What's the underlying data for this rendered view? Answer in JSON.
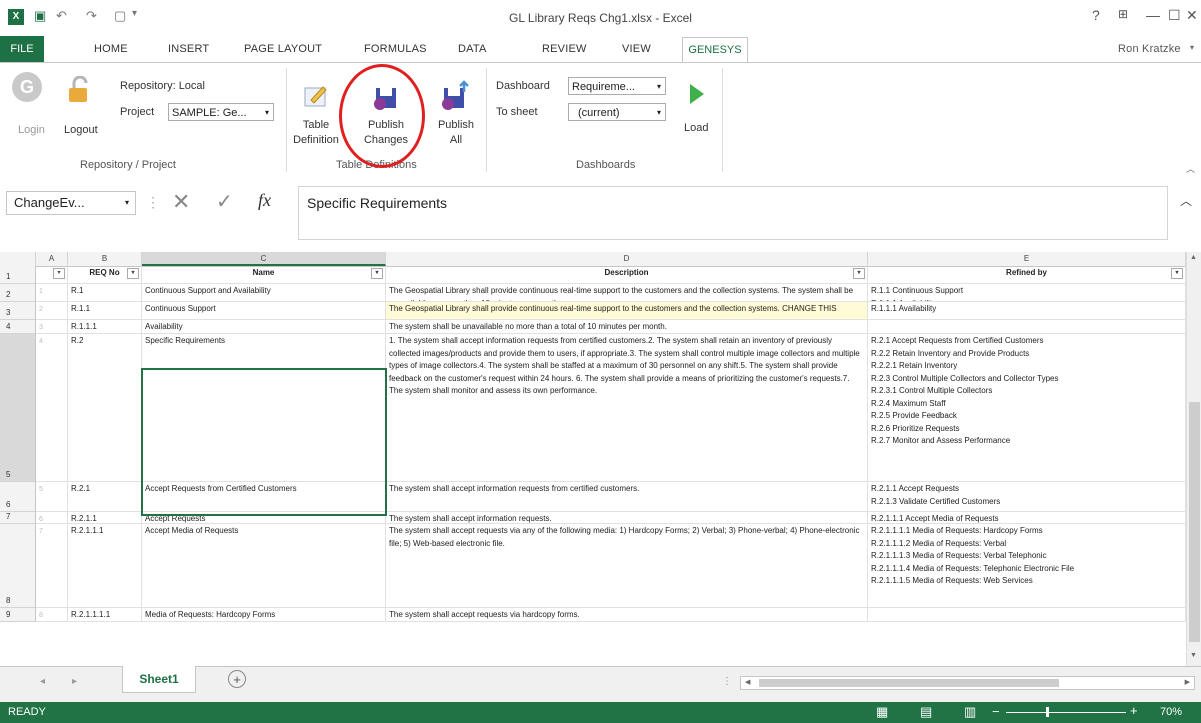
{
  "app": {
    "title": "GL Library Reqs Chg1.xlsx - Excel",
    "user": "Ron Kratzke",
    "window_controls": [
      "?",
      "□",
      "—",
      "☐",
      "✕"
    ]
  },
  "ribbon_tabs": [
    {
      "label": "FILE"
    },
    {
      "label": "HOME"
    },
    {
      "label": "INSERT"
    },
    {
      "label": "PAGE LAYOUT"
    },
    {
      "label": "FORMULAS"
    },
    {
      "label": "DATA"
    },
    {
      "label": "REVIEW"
    },
    {
      "label": "VIEW"
    },
    {
      "label": "GENESYS",
      "active": true
    }
  ],
  "ribbon": {
    "repo": {
      "login": "Login",
      "logout": "Logout",
      "repository_label": "Repository: Local",
      "project_label": "Project",
      "project_value": "SAMPLE: Ge...",
      "group_label": "Repository / Project"
    },
    "table": {
      "table_definition": [
        "Table",
        "Definition"
      ],
      "publish_changes": [
        "Publish",
        "Changes"
      ],
      "publish_all": [
        "Publish",
        "All"
      ],
      "group_label": "Table Definitions"
    },
    "dash": {
      "dashboard_label": "Dashboard",
      "dashboard_value": "Requireme...",
      "tosheet_label": "To sheet",
      "tosheet_value": "(current)",
      "load": "Load",
      "group_label": "Dashboards"
    }
  },
  "formula_bar": {
    "name_box": "ChangeEv...",
    "fx": "fx",
    "content": "Specific Requirements"
  },
  "columns": [
    "A",
    "B",
    "C",
    "D",
    "E"
  ],
  "headers": {
    "b": "REQ No",
    "c": "Name",
    "d": "Description",
    "e": "Refined by"
  },
  "rows": [
    {
      "num": "2",
      "a": "1",
      "b": "R.1",
      "c": "Continuous Support and Availability",
      "d": "The Geospatial Library shall provide continuous real-time support to the customers and the collection systems. The system shall be unavailable no more than 10 minutes per month.",
      "e": [
        "R.1.1 Continuous Support",
        "R.1.1.1 Availability"
      ]
    },
    {
      "num": "3",
      "a": "2",
      "b": "R.1.1",
      "c": "Continuous Support",
      "d": "The Geospatial Library shall provide continuous real-time support to the customers and the collection systems.  CHANGE THIS",
      "e": [
        "R.1.1.1 Availability"
      ]
    },
    {
      "num": "4",
      "a": "3",
      "b": "R.1.1.1",
      "c": "Availability",
      "d": "The system shall be unavailable no more than a total of 10 minutes per month.",
      "e": []
    },
    {
      "num": "5",
      "a": "4",
      "b": "R.2",
      "c": "Specific Requirements",
      "d": "1. The system shall accept information requests from certified customers.2. The system shall retain an inventory of previously collected images/products and provide them to users, if appropriate.3. The system shall control multiple image collectors and multiple types of image collectors.4. The system shall be staffed at a maximum of 30 personnel on any shift.5. The system shall provide feedback on the customer's request within 24 hours. 6. The system shall provide a means of prioritizing the customer's requests.7. The system shall monitor and assess its own performance.",
      "e": [
        "R.2.1 Accept Requests from Certified Customers",
        "R.2.2 Retain Inventory and Provide Products",
        "R.2.2.1 Retain Inventory",
        "R.2.3 Control Multiple Collectors and Collector Types",
        "R.2.3.1 Control Multiple Collectors",
        "R.2.4 Maximum Staff",
        "R.2.5 Provide Feedback",
        "R.2.6 Prioritize Requests",
        "R.2.7 Monitor and Assess Performance"
      ]
    },
    {
      "num": "6",
      "a": "5",
      "b": "R.2.1",
      "c": "Accept Requests from Certified Customers",
      "d": "The system shall accept information requests from certified customers.",
      "e": [
        "R.2.1.1 Accept Requests",
        "R.2.1.3 Validate Certified Customers"
      ]
    },
    {
      "num": "7",
      "a": "6",
      "b": "R.2.1.1",
      "c": "Accept Requests",
      "d": "The system shall accept information requests.",
      "e": [
        "R.2.1.1.1 Accept Media of Requests"
      ]
    },
    {
      "num": "8",
      "a": "7",
      "b": "R.2.1.1.1",
      "c": "Accept Media of Requests",
      "d": "The system shall accept requests via any of the following media: 1) Hardcopy Forms; 2) Verbal; 3) Phone-verbal; 4) Phone-electronic file; 5) Web-based electronic file.",
      "e": [
        "R.2.1.1.1.1 Media of Requests: Hardcopy Forms",
        "R.2.1.1.1.2 Media of Requests: Verbal",
        "R.2.1.1.1.3 Media of Requests: Verbal Telephonic",
        "R.2.1.1.1.4 Media of Requests: Telephonic Electronic File",
        "R.2.1.1.1.5 Media of Requests: Web Services"
      ]
    },
    {
      "num": "9",
      "a": "8",
      "b": "R.2.1.1.1.1",
      "c": "Media of Requests: Hardcopy Forms",
      "d": "The system shall accept requests via hardcopy forms.",
      "e": []
    }
  ],
  "sheet_tabs": {
    "sheet1": "Sheet1",
    "add": "+"
  },
  "status": {
    "ready": "READY",
    "zoom": "70%"
  },
  "colors": {
    "excel_green": "#217346",
    "highlight": "#fffbd6",
    "annotation": "#e02020"
  }
}
